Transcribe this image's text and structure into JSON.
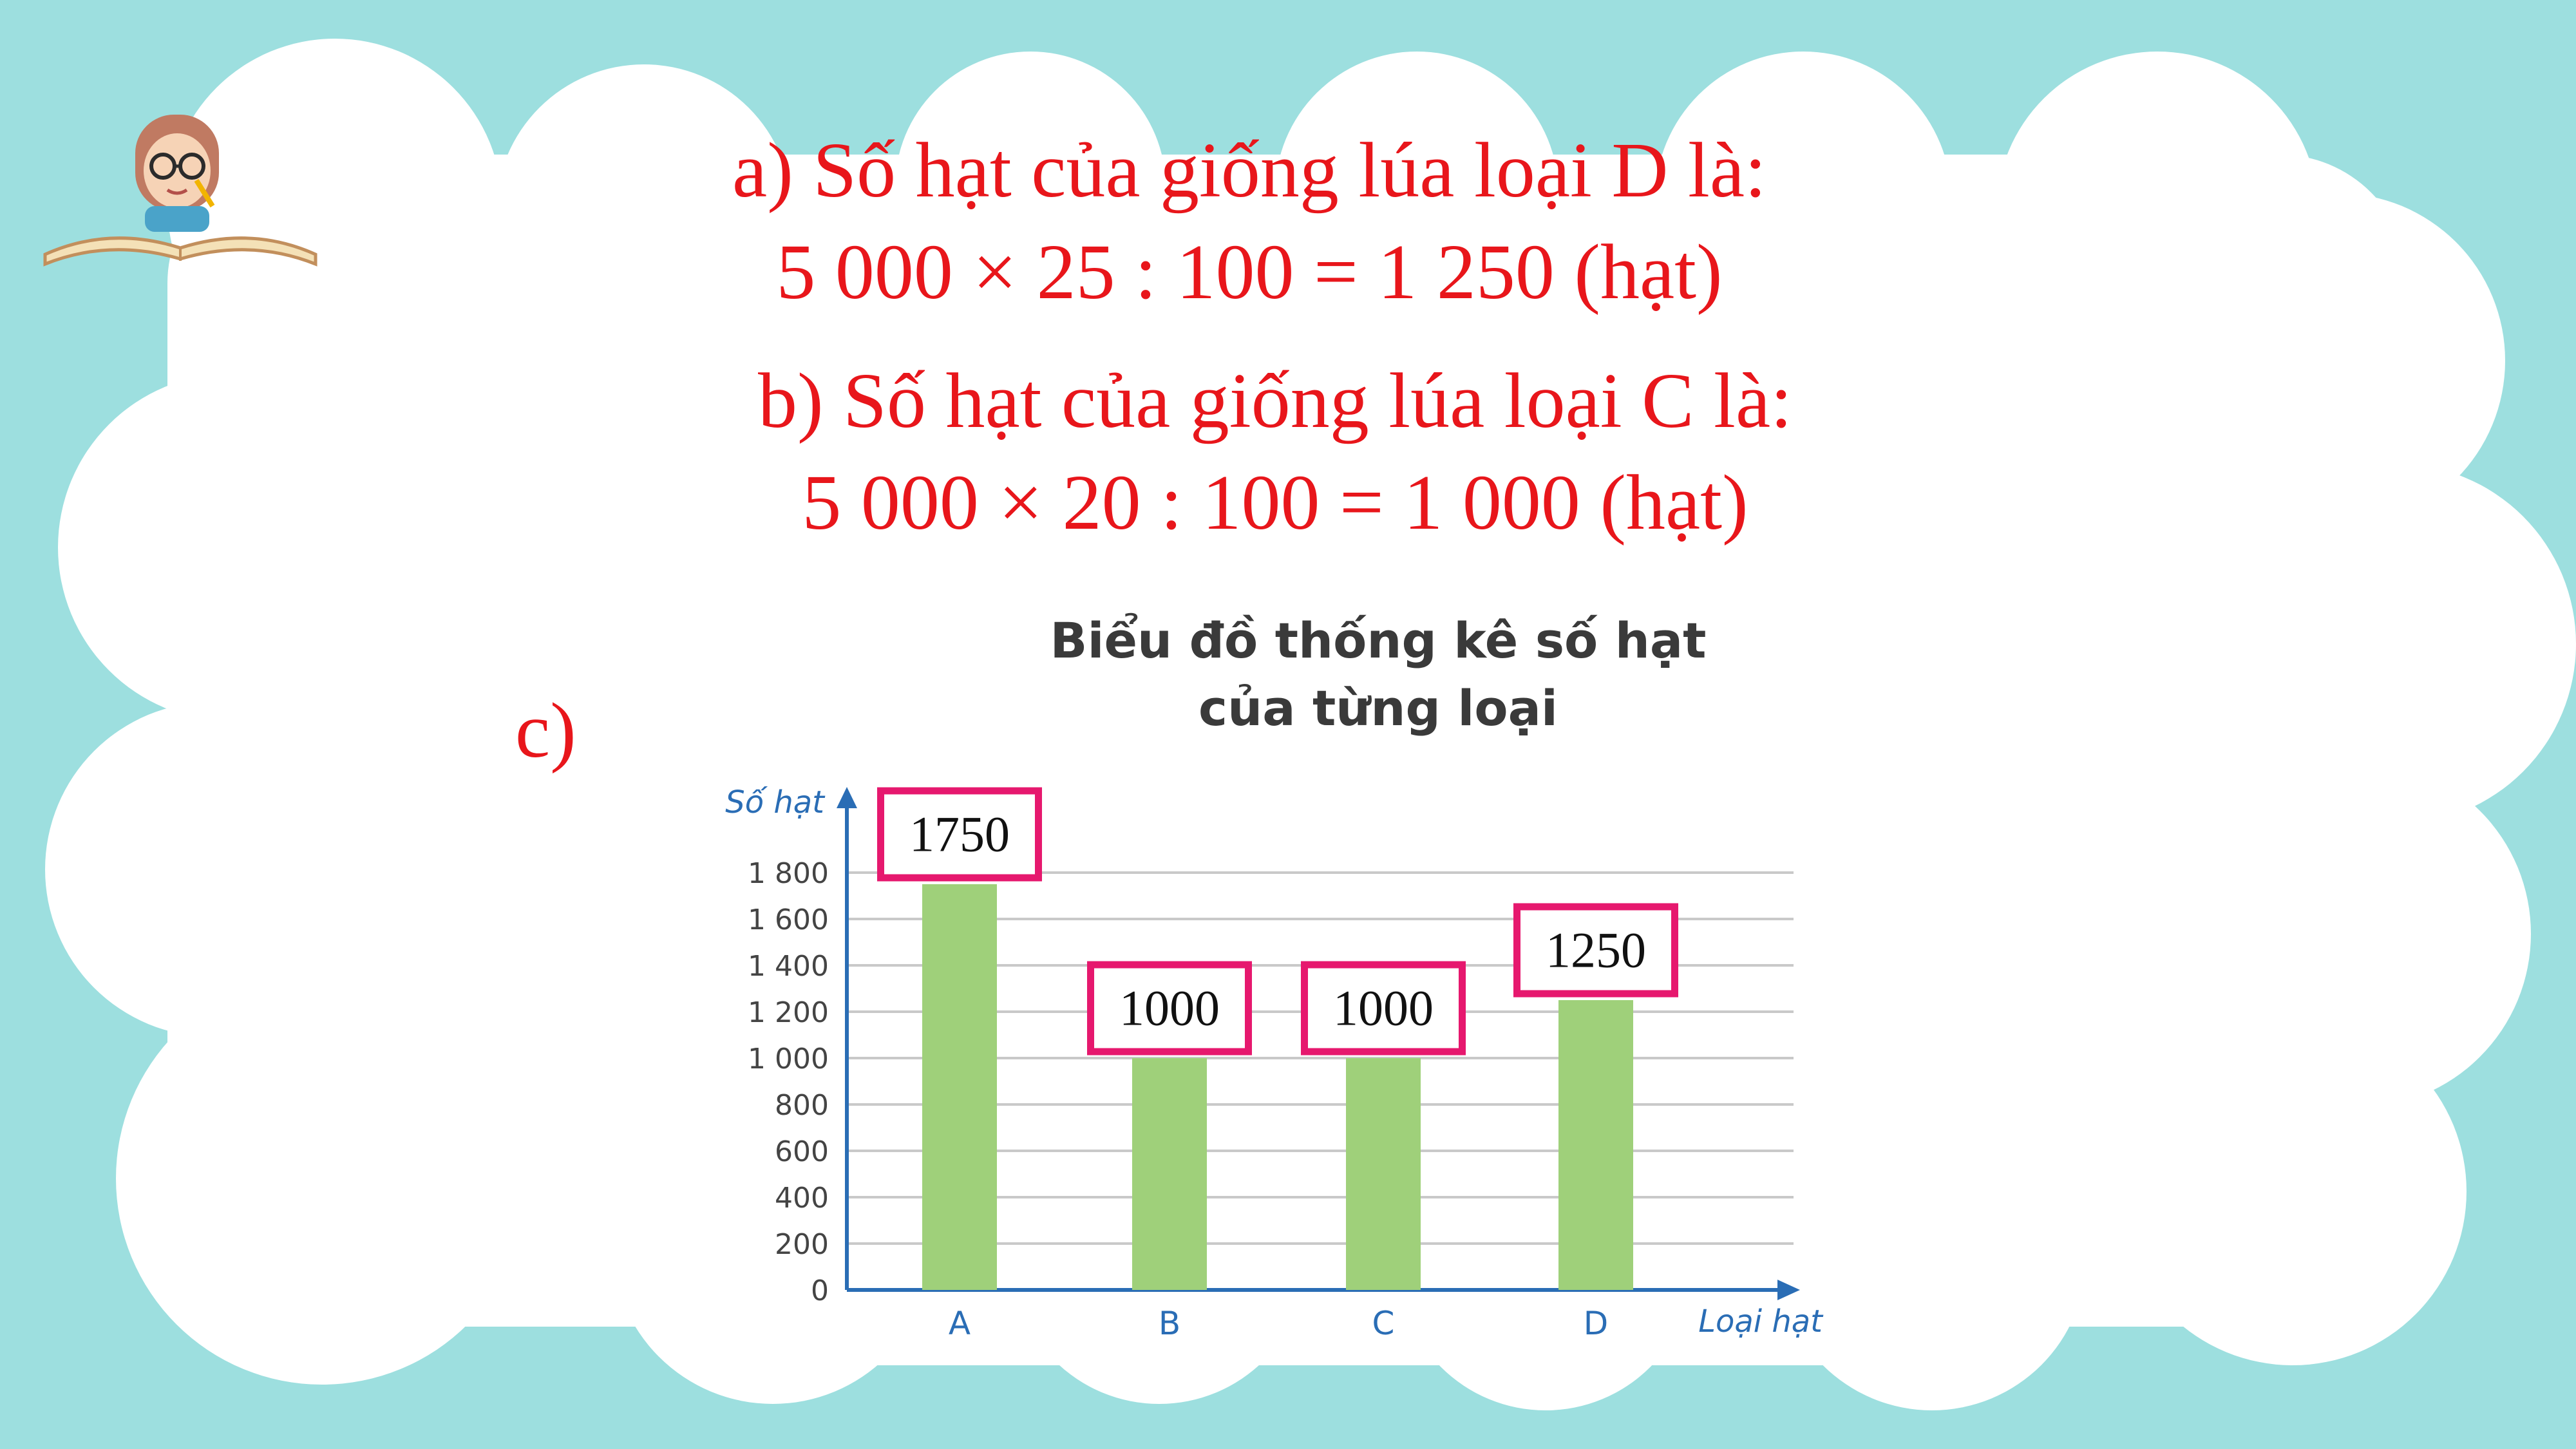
{
  "solution": {
    "a_line1": "a)  Số hạt của giống lúa loại D là:",
    "a_line2": "5 000 × 25 : 100 = 1 250 (hạt)",
    "b_line1": "b) Số hạt của giống lúa loại C là:",
    "b_line2": "5 000 × 20 : 100 = 1 000 (hạt)",
    "c_label": "c)"
  },
  "colors": {
    "background": "#9ddfdf",
    "cloud": "#ffffff",
    "text_red": "#e8161b",
    "bar_green": "#9fd07a",
    "highlight_box": "#e6186e",
    "axis_blue": "#2a6db5"
  },
  "chart_data": {
    "type": "bar",
    "title_line1": "Biểu đồ thống kê số hạt",
    "title_line2": "của từng loại",
    "ylabel": "Số hạt",
    "xlabel": "Loại hạt",
    "categories": [
      "A",
      "B",
      "C",
      "D"
    ],
    "values": [
      1750,
      1000,
      1000,
      1250
    ],
    "value_labels": [
      "1750",
      "1000",
      "1000",
      "1250"
    ],
    "ylim": [
      0,
      1800
    ],
    "yticks": [
      0,
      200,
      400,
      600,
      800,
      1000,
      1200,
      1400,
      1600,
      1800
    ],
    "ytick_labels": [
      "0",
      "200",
      "400",
      "600",
      "800",
      "1 000",
      "1 200",
      "1 400",
      "1 600",
      "1 800"
    ],
    "grid": true,
    "legend": "none"
  },
  "icons": [
    "girl-reading-book-icon"
  ]
}
